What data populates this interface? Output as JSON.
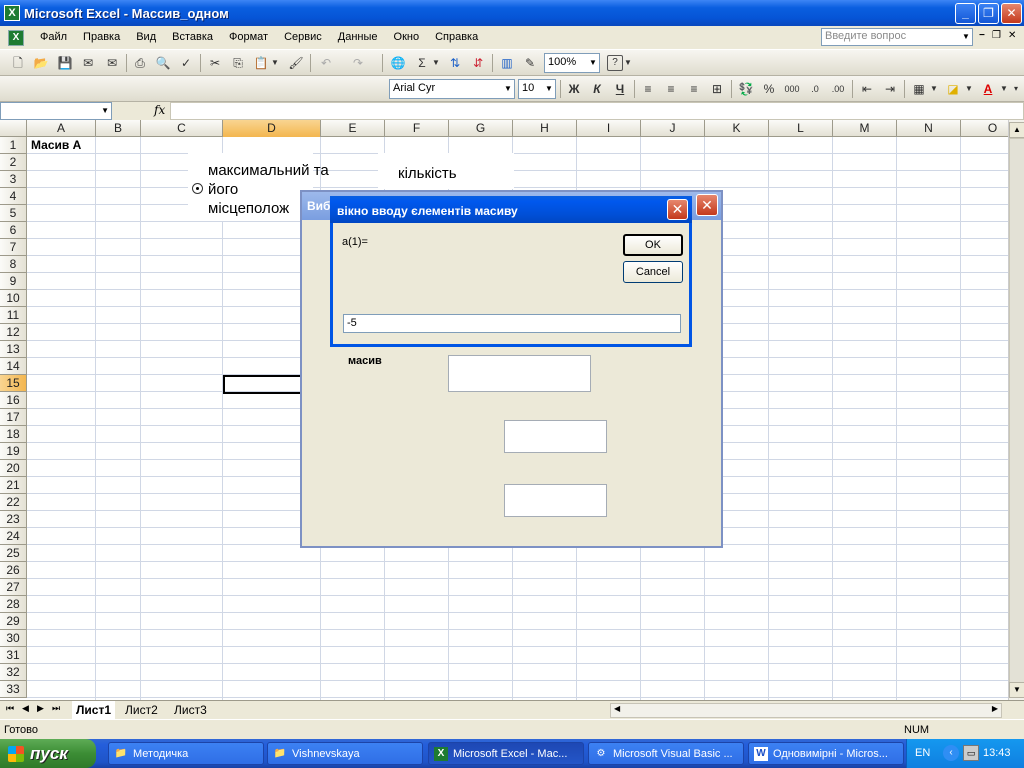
{
  "window": {
    "title": "Microsoft Excel - Массив_одном",
    "minimize_label": "_",
    "restore_label": "❐",
    "close_label": "✕"
  },
  "menu": {
    "items": [
      "Файл",
      "Правка",
      "Вид",
      "Вставка",
      "Формат",
      "Сервис",
      "Данные",
      "Окно",
      "Справка"
    ],
    "ask_placeholder": "Введите вопрос"
  },
  "toolbar": {
    "zoom": "100%",
    "font_name": "Arial Cyr",
    "font_size": "10",
    "bold_label": "Ж",
    "italic_label": "К",
    "underline_label": "Ч",
    "help_glyph": "?"
  },
  "formula_bar": {
    "name_box": "",
    "fx_label": "fx",
    "formula": ""
  },
  "grid": {
    "columns": [
      "A",
      "B",
      "C",
      "D",
      "E",
      "F",
      "G",
      "H",
      "I",
      "J",
      "K",
      "L",
      "M",
      "N",
      "O"
    ],
    "active_column": "D",
    "rows": [
      "1",
      "2",
      "3",
      "4",
      "5",
      "6",
      "7",
      "8",
      "9",
      "10",
      "11",
      "12",
      "13",
      "14",
      "15",
      "16",
      "17",
      "18",
      "19",
      "20",
      "21",
      "22",
      "23",
      "24",
      "25",
      "26",
      "27",
      "28",
      "29",
      "30",
      "31",
      "32",
      "33"
    ],
    "active_row": "15",
    "cell_a1": "Масив А"
  },
  "sheet_controls": {
    "option1_lines": [
      "максимальний та",
      "його",
      "місцеполож"
    ],
    "option2_line": "кількість"
  },
  "vba_form": {
    "title_visible": "Виб",
    "masiv_label": "масив",
    "close_label": "✕"
  },
  "input_dialog": {
    "title": "вікно вводу єлементів масиву",
    "prompt": "a(1)=",
    "ok_label": "OK",
    "cancel_label": "Cancel",
    "value": "-5",
    "close_label": "✕"
  },
  "sheet_tabs": {
    "tabs": [
      "Лист1",
      "Лист2",
      "Лист3"
    ],
    "active": "Лист1"
  },
  "status_bar": {
    "status": "Готово",
    "num_indicator": "NUM"
  },
  "taskbar": {
    "start_label": "пуск",
    "tasks": [
      {
        "label": "Методичка",
        "icon": "folder-icon"
      },
      {
        "label": "Vishnevskaya",
        "icon": "folder-icon"
      },
      {
        "label": "Microsoft Excel - Мас...",
        "icon": "excel-icon"
      },
      {
        "label": "Microsoft Visual Basic ...",
        "icon": "vb-icon"
      },
      {
        "label": "Одновимірні - Micros...",
        "icon": "word-icon"
      }
    ],
    "language": "EN",
    "clock": "13:43"
  }
}
